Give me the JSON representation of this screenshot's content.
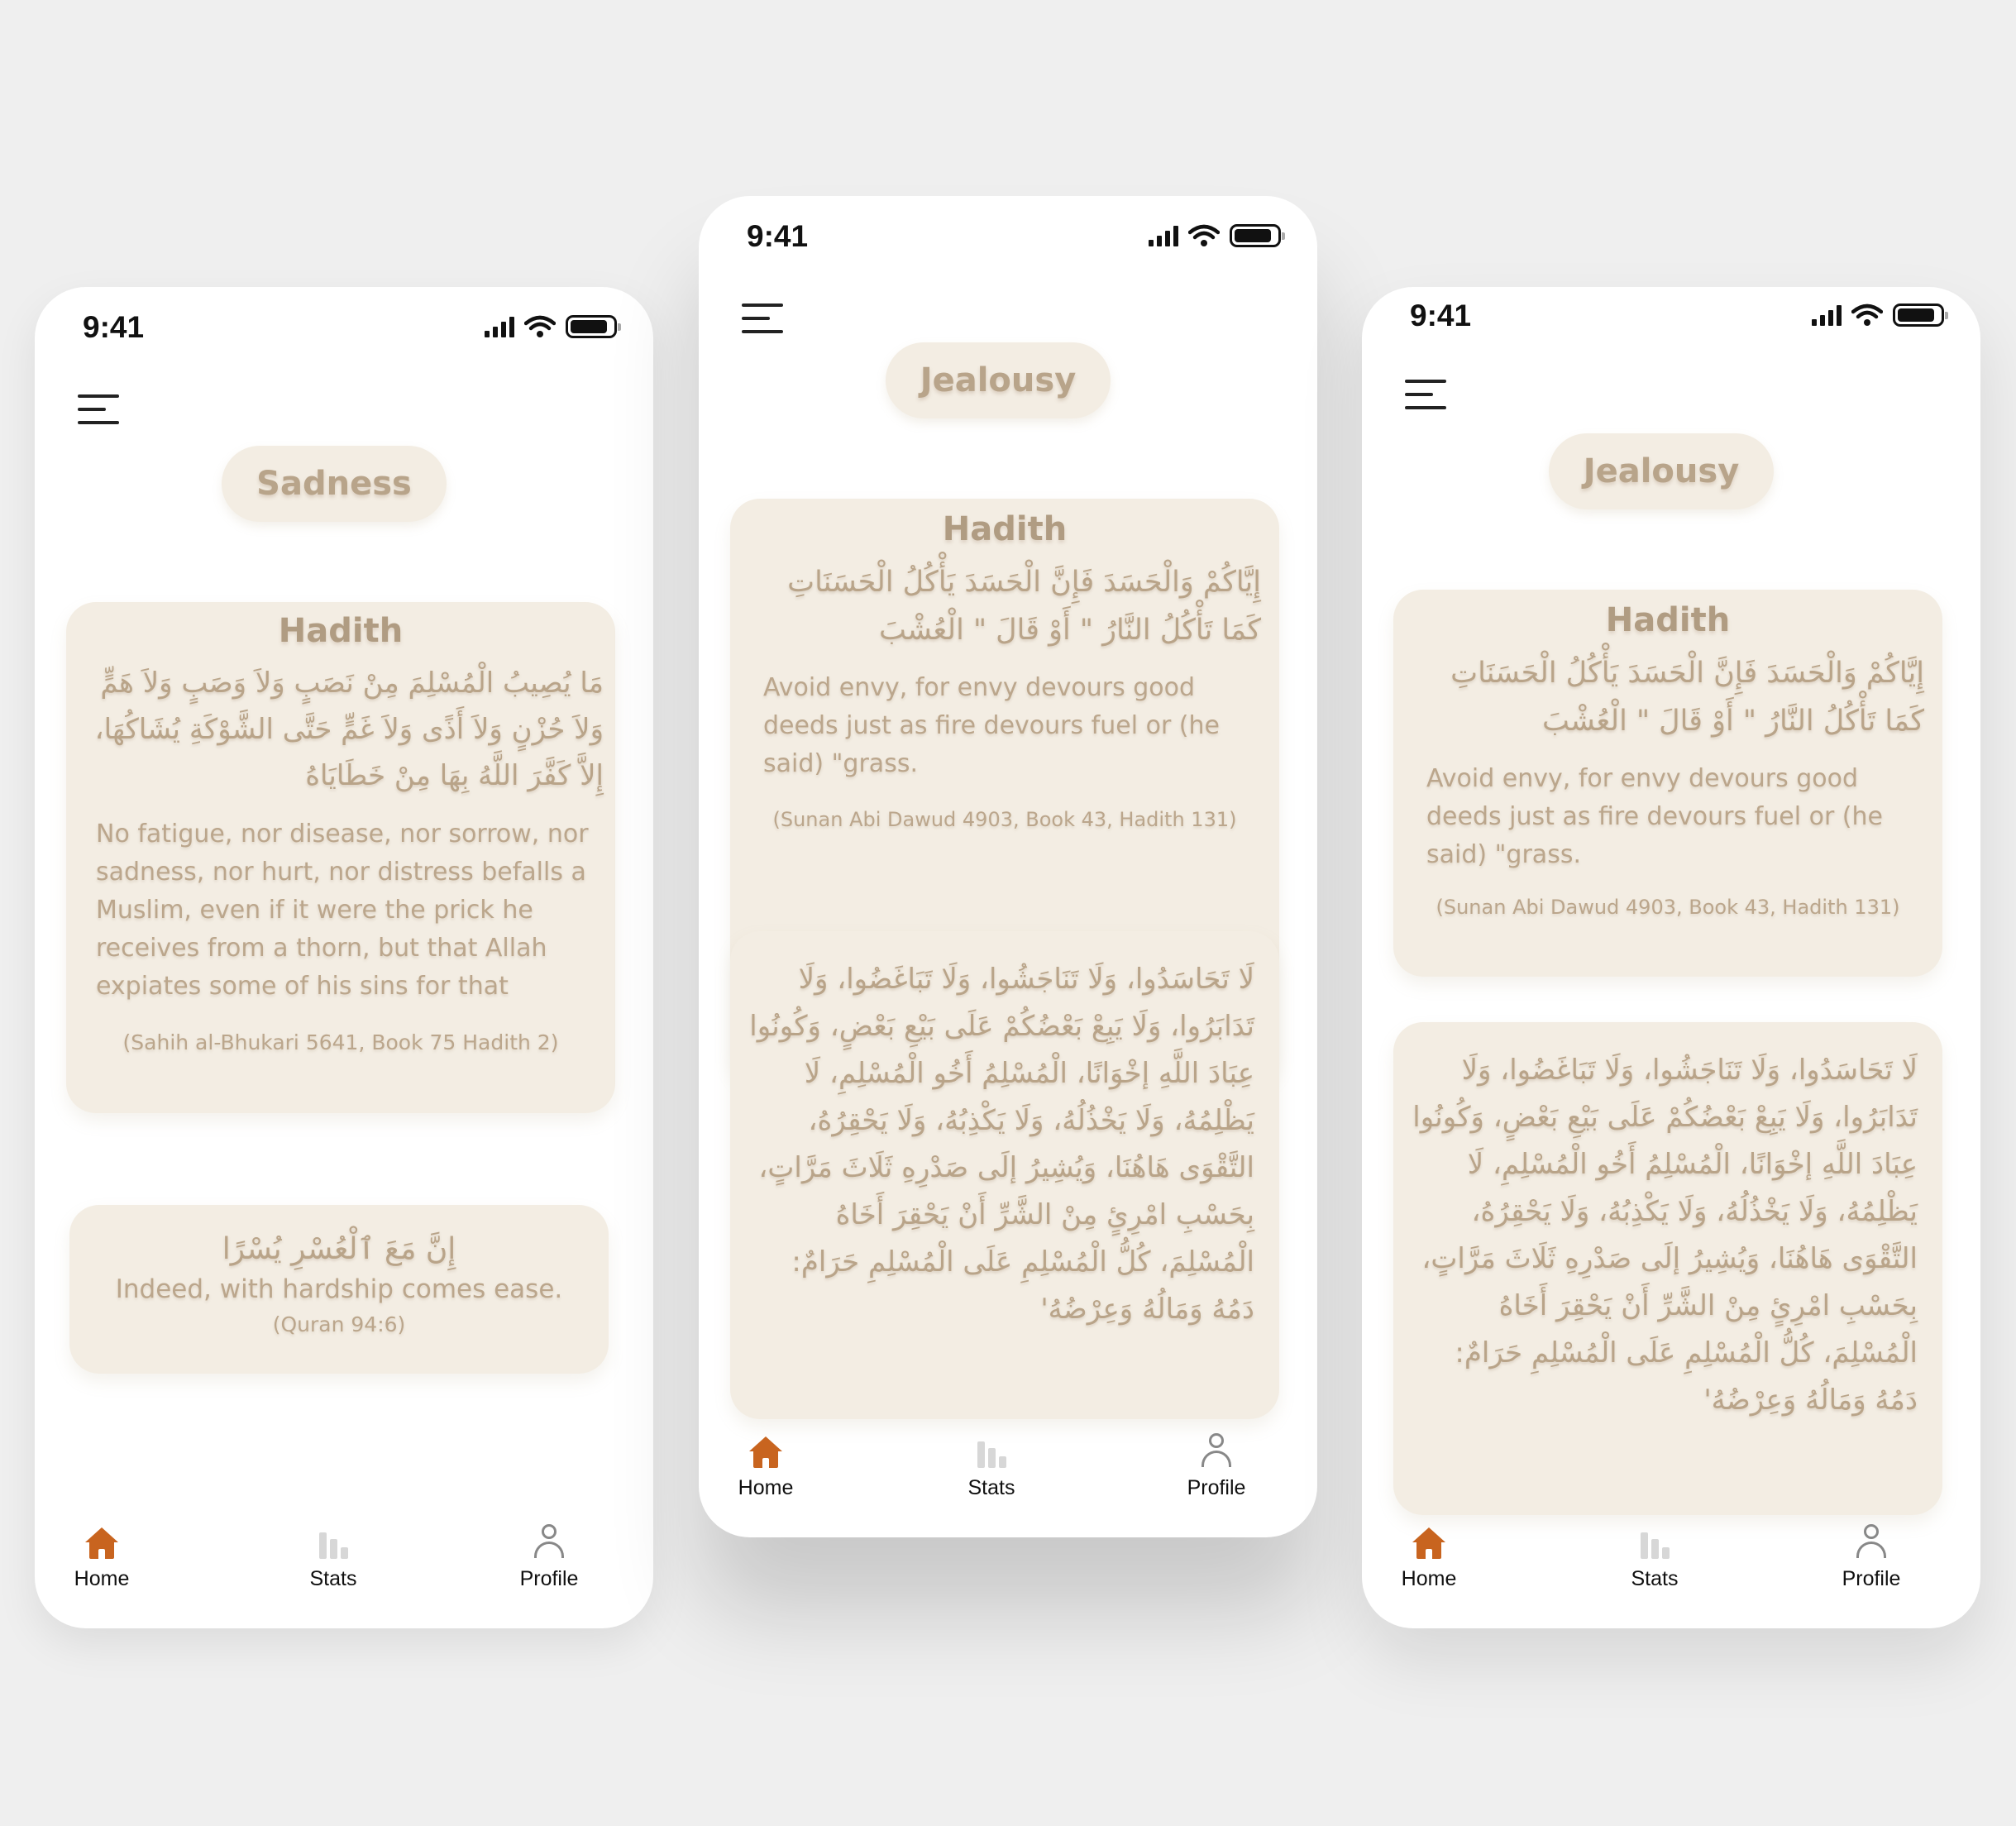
{
  "status_bar": {
    "time": "9:41"
  },
  "nav": {
    "home": "Home",
    "stats": "Stats",
    "profile": "Profile"
  },
  "colors": {
    "accent": "#c8641f",
    "card_bg": "#f3ede3",
    "card_text": "#bba68c"
  },
  "screens": [
    {
      "topic": "Sadness",
      "hadith_card": {
        "title": "Hadith",
        "arabic": "مَا يُصِيبُ الْمُسْلِمَ مِنْ نَصَبٍ وَلاَ وَصَبٍ وَلاَ هَمٍّ وَلاَ حُزْنٍ وَلاَ أَذًى وَلاَ غَمٍّ حَتَّى الشَّوْكَةِ يُشَاكُهَا، إِلاَّ كَفَّرَ اللَّهُ بِهَا مِنْ خَطَايَاهُ",
        "english": "No fatigue, nor disease, nor sorrow, nor sadness, nor hurt, nor distress befalls a Muslim, even if it were the prick he receives from a thorn, but that Allah expiates some of his sins for that",
        "reference": "(Sahih al-Bhukari 5641, Book 75 Hadith 2)"
      },
      "quran_card": {
        "arabic": "إِنَّ مَعَ ٱلْعُسْرِ يُسْرًا",
        "english": "Indeed, with hardship comes ease.",
        "reference": "(Quran 94:6)"
      }
    },
    {
      "topic": "Jealousy",
      "hadith_card": {
        "title": "Hadith",
        "arabic": "إِيَّاكُمْ وَالْحَسَدَ فَإِنَّ الْحَسَدَ يَأْكُلُ الْحَسَنَاتِ كَمَا تَأْكُلُ النَّارُ \" أَوْ قَالَ \" الْعُشْبَ",
        "english": "Avoid envy, for envy devours good deeds just as fire devours fuel or (he said) \"grass.",
        "reference": "(Sunan Abi Dawud 4903, Book 43, Hadith 131)"
      },
      "second_card": {
        "arabic": "لَا تَحَاسَدُوا، وَلَا تَنَاجَشُوا، وَلَا تَبَاغَضُوا، وَلَا تَدَابَرُوا، وَلَا يَبِعْ بَعْضُكُمْ عَلَى بَيْعِ بَعْضٍ، وَكُونُوا عِبَادَ اللَّهِ إخْوَانًا، الْمُسْلِمُ أَخُو الْمُسْلِمِ، لَا يَظْلِمُهُ، وَلَا يَخْذُلُهُ، وَلَا يَكْذِبُهُ، وَلَا يَحْقِرُهُ، التَّقْوَى هَاهُنَا، وَيُشِيرُ إلَى صَدْرِهِ ثَلَاثَ مَرَّاتٍ، بِحَسْبِ امْرِئٍ مِنْ الشَّرِّ أَنْ يَحْقِرَ أَخَاهُ الْمُسْلِمَ، كُلُّ الْمُسْلِمِ عَلَى الْمُسْلِمِ حَرَامٌ: دَمُهُ وَمَالُهُ وَعِرْضُهُ'"
      }
    },
    {
      "topic": "Jealousy",
      "hadith_card": {
        "title": "Hadith",
        "arabic": "إِيَّاكُمْ وَالْحَسَدَ فَإِنَّ الْحَسَدَ يَأْكُلُ الْحَسَنَاتِ كَمَا تَأْكُلُ النَّارُ \" أَوْ قَالَ \" الْعُشْبَ",
        "english": "Avoid envy, for envy devours good deeds just as fire devours fuel or (he said) \"grass.",
        "reference": "(Sunan Abi Dawud 4903, Book 43, Hadith 131)"
      },
      "second_card": {
        "arabic": "لَا تَحَاسَدُوا، وَلَا تَنَاجَشُوا، وَلَا تَبَاغَضُوا، وَلَا تَدَابَرُوا، وَلَا يَبِعْ بَعْضُكُمْ عَلَى بَيْعِ بَعْضٍ، وَكُونُوا عِبَادَ اللَّهِ إخْوَانًا، الْمُسْلِمُ أَخُو الْمُسْلِمِ، لَا يَظْلِمُهُ، وَلَا يَخْذُلُهُ، وَلَا يَكْذِبُهُ، وَلَا يَحْقِرُهُ، التَّقْوَى هَاهُنَا، وَيُشِيرُ إلَى صَدْرِهِ ثَلَاثَ مَرَّاتٍ، بِحَسْبِ امْرِئٍ مِنْ الشَّرِّ أَنْ يَحْقِرَ أَخَاهُ الْمُسْلِمَ، كُلُّ الْمُسْلِمِ عَلَى الْمُسْلِمِ حَرَامٌ: دَمُهُ وَمَالُهُ وَعِرْضُهُ'"
      }
    }
  ]
}
